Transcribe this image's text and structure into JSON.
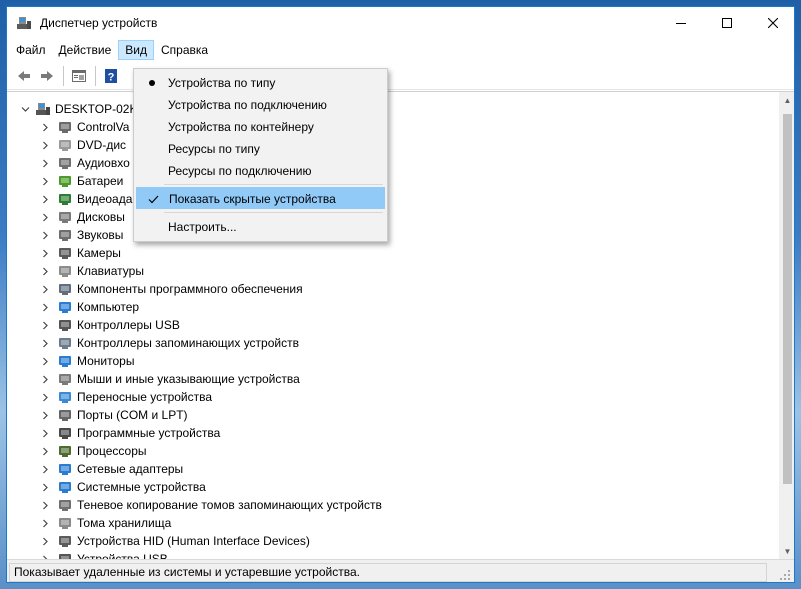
{
  "window": {
    "title": "Диспетчер устройств",
    "controls": {
      "minimize": "—",
      "maximize": "☐",
      "close": "✕"
    }
  },
  "menubar": [
    "Файл",
    "Действие",
    "Вид",
    "Справка"
  ],
  "view_menu": {
    "items": [
      {
        "label": "Устройства по типу",
        "mark": "bullet"
      },
      {
        "label": "Устройства по подключению",
        "mark": ""
      },
      {
        "label": "Устройства по контейнеру",
        "mark": ""
      },
      {
        "label": "Ресурсы по типу",
        "mark": ""
      },
      {
        "label": "Ресурсы по подключению",
        "mark": ""
      },
      {
        "label": "Показать скрытые устройства",
        "mark": "check",
        "highlighted": true
      },
      {
        "label": "Настроить...",
        "mark": ""
      }
    ]
  },
  "tree": {
    "root": "DESKTOP-02K",
    "items": [
      {
        "label": "ControlVa",
        "icon": "controlvault-icon"
      },
      {
        "label": "DVD-дис",
        "icon": "dvd-drive-icon"
      },
      {
        "label": "Аудиовхо",
        "icon": "audio-icon"
      },
      {
        "label": "Батареи",
        "icon": "battery-icon"
      },
      {
        "label": "Видеоада",
        "icon": "display-adapter-icon"
      },
      {
        "label": "Дисковы",
        "icon": "disk-drive-icon"
      },
      {
        "label": "Звуковы",
        "icon": "sound-icon"
      },
      {
        "label": "Камеры",
        "icon": "camera-icon"
      },
      {
        "label": "Клавиатуры",
        "icon": "keyboard-icon"
      },
      {
        "label": "Компоненты программного обеспечения",
        "icon": "software-component-icon"
      },
      {
        "label": "Компьютер",
        "icon": "computer-icon"
      },
      {
        "label": "Контроллеры USB",
        "icon": "usb-icon"
      },
      {
        "label": "Контроллеры запоминающих устройств",
        "icon": "storage-controller-icon"
      },
      {
        "label": "Мониторы",
        "icon": "monitor-icon"
      },
      {
        "label": "Мыши и иные указывающие устройства",
        "icon": "mouse-icon"
      },
      {
        "label": "Переносные устройства",
        "icon": "portable-device-icon"
      },
      {
        "label": "Порты (COM и LPT)",
        "icon": "port-icon"
      },
      {
        "label": "Программные устройства",
        "icon": "software-device-icon"
      },
      {
        "label": "Процессоры",
        "icon": "processor-icon"
      },
      {
        "label": "Сетевые адаптеры",
        "icon": "network-adapter-icon"
      },
      {
        "label": "Системные устройства",
        "icon": "system-device-icon"
      },
      {
        "label": "Теневое копирование томов запоминающих устройств",
        "icon": "shadow-copy-icon"
      },
      {
        "label": "Тома хранилища",
        "icon": "storage-volume-icon"
      },
      {
        "label": "Устройства HID (Human Interface Devices)",
        "icon": "hid-icon"
      },
      {
        "label": "Устройства USB",
        "icon": "usb-device-icon"
      }
    ]
  },
  "statusbar": {
    "text": "Показывает удаленные из системы и устаревшие устройства."
  },
  "colors": {
    "accent": "#1979ca",
    "menu_highlight": "#91c9f7",
    "menu_active": "#cce8ff"
  }
}
